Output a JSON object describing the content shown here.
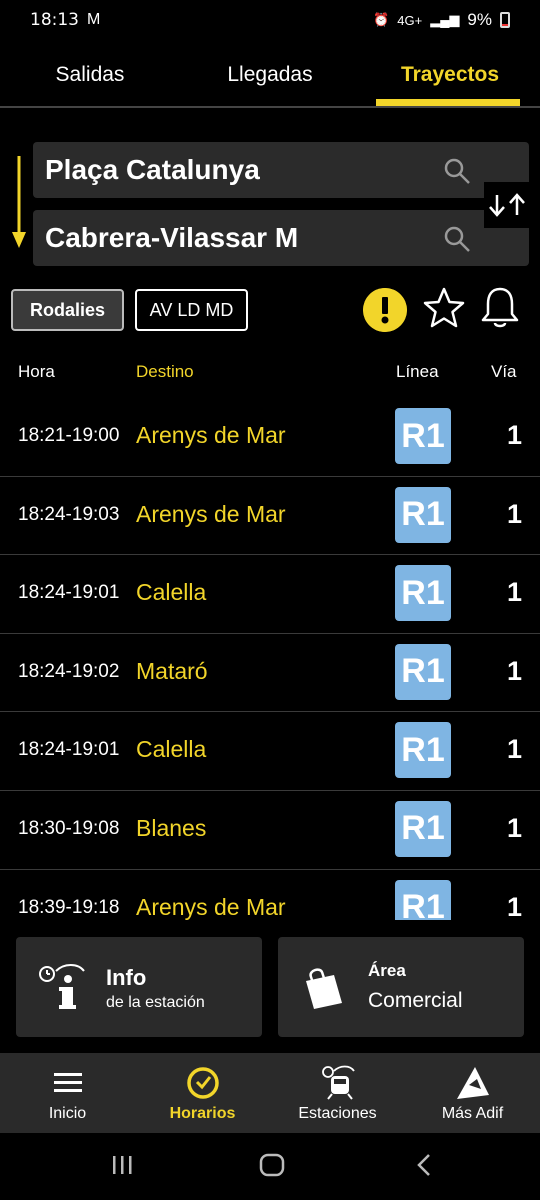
{
  "status": {
    "time": "18:13",
    "network": "4G+",
    "battery": "9%"
  },
  "tabs": [
    {
      "label": "Salidas"
    },
    {
      "label": "Llegadas"
    },
    {
      "label": "Trayectos",
      "active": true
    }
  ],
  "route": {
    "origin": "Plaça Catalunya",
    "destination": "Cabrera-Vilassar M"
  },
  "filters": {
    "rodalies": "Rodalies",
    "avldmd": "AV LD MD"
  },
  "table": {
    "headers": {
      "hora": "Hora",
      "destino": "Destino",
      "linea": "Línea",
      "via": "Vía"
    },
    "rows": [
      {
        "hora": "18:21-19:00",
        "destino": "Arenys de Mar",
        "linea": "R1",
        "via": "1"
      },
      {
        "hora": "18:24-19:03",
        "destino": "Arenys de Mar",
        "linea": "R1",
        "via": "1"
      },
      {
        "hora": "18:24-19:01",
        "destino": "Calella",
        "linea": "R1",
        "via": "1"
      },
      {
        "hora": "18:24-19:02",
        "destino": "Mataró",
        "linea": "R1",
        "via": "1"
      },
      {
        "hora": "18:24-19:01",
        "destino": "Calella",
        "linea": "R1",
        "via": "1"
      },
      {
        "hora": "18:30-19:08",
        "destino": "Blanes",
        "linea": "R1",
        "via": "1"
      },
      {
        "hora": "18:39-19:18",
        "destino": "Arenys de Mar",
        "linea": "R1",
        "via": "1"
      }
    ]
  },
  "cards": {
    "info": {
      "title": "Info",
      "subtitle": "de la estación"
    },
    "area": {
      "title": "Área",
      "subtitle": "Comercial"
    }
  },
  "nav": [
    {
      "label": "Inicio"
    },
    {
      "label": "Horarios",
      "active": true
    },
    {
      "label": "Estaciones"
    },
    {
      "label": "Más Adif"
    }
  ],
  "colors": {
    "accent": "#f2d52a",
    "line_r1": "#7fb5e3",
    "background": "#000000",
    "surface": "#2a2a2a"
  }
}
